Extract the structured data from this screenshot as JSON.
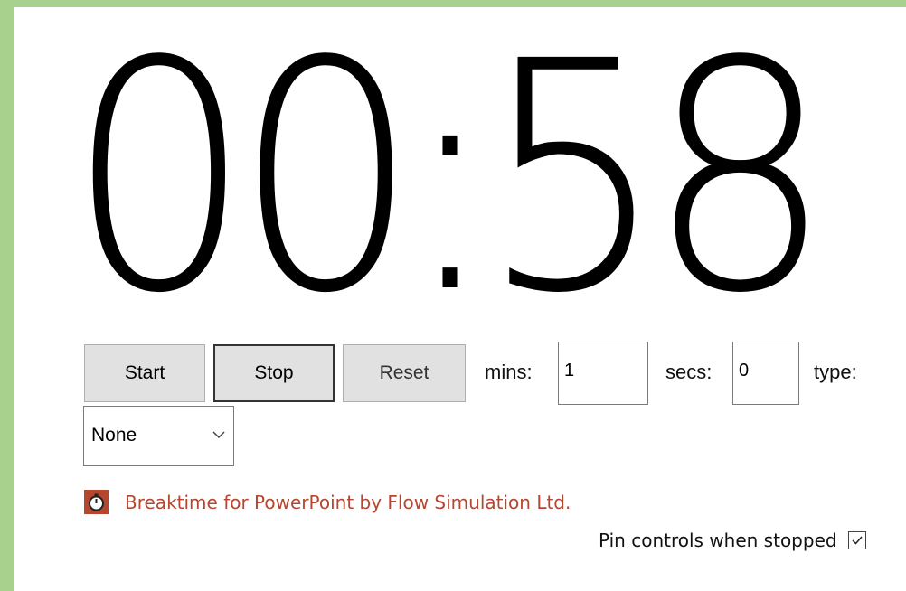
{
  "timer": {
    "display": "00:58"
  },
  "controls": {
    "start_label": "Start",
    "stop_label": "Stop",
    "reset_label": "Reset",
    "mins_label": "mins:",
    "mins_value": "1",
    "secs_label": "secs:",
    "secs_value": "0",
    "type_label": "type:",
    "type_selected": "None"
  },
  "footer": {
    "credit_text": "Breaktime for PowerPoint by Flow Simulation Ltd.",
    "credit_icon": "stopwatch-icon",
    "pin_label": "Pin controls when stopped",
    "pin_checked": true
  },
  "colors": {
    "frame": "#a9d18e",
    "accent": "#b5462f"
  }
}
